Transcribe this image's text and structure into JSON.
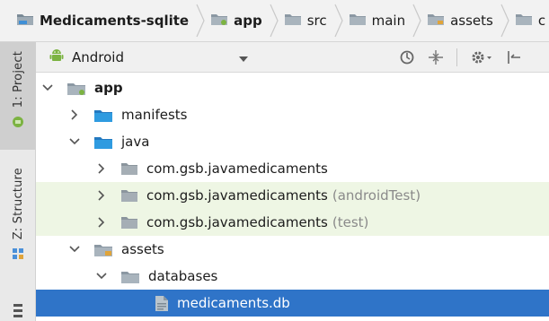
{
  "breadcrumb": {
    "items": [
      {
        "label": "Medicaments-sqlite",
        "bold": true,
        "icon": "project-folder-icon"
      },
      {
        "label": "app",
        "bold": true,
        "icon": "module-folder-icon"
      },
      {
        "label": "src",
        "bold": false,
        "icon": "folder-icon"
      },
      {
        "label": "main",
        "bold": false,
        "icon": "folder-icon"
      },
      {
        "label": "assets",
        "bold": false,
        "icon": "assets-folder-icon"
      },
      {
        "label": "c",
        "bold": false,
        "icon": "folder-icon"
      }
    ]
  },
  "side_tabs": {
    "project": "1: Project",
    "structure": "Z: Structure"
  },
  "panel": {
    "view_mode": "Android",
    "icons": [
      "sync-icon",
      "collapse-icon",
      "settings-icon",
      "hide-icon"
    ]
  },
  "tree": [
    {
      "label": "app",
      "suffix": "",
      "expanded": true,
      "has_arrow": true
    },
    {
      "label": "manifests",
      "suffix": "",
      "expanded": false,
      "has_arrow": true
    },
    {
      "label": "java",
      "suffix": "",
      "expanded": true,
      "has_arrow": true
    },
    {
      "label": "com.gsb.javamedicaments",
      "suffix": "",
      "expanded": false,
      "has_arrow": true
    },
    {
      "label": "com.gsb.javamedicaments",
      "suffix": "(androidTest)",
      "expanded": false,
      "has_arrow": true
    },
    {
      "label": "com.gsb.javamedicaments",
      "suffix": "(test)",
      "expanded": false,
      "has_arrow": true
    },
    {
      "label": "assets",
      "suffix": "",
      "expanded": true,
      "has_arrow": true
    },
    {
      "label": "databases",
      "suffix": "",
      "expanded": true,
      "has_arrow": true
    },
    {
      "label": "medicaments.db",
      "suffix": "",
      "expanded": false,
      "has_arrow": false
    }
  ],
  "colors": {
    "selection": "#2f74c8",
    "test_tint": "#eef6e4",
    "folder_blue": "#2f9be0",
    "package_gray": "#9aa4ad",
    "android_green": "#7cb342"
  }
}
